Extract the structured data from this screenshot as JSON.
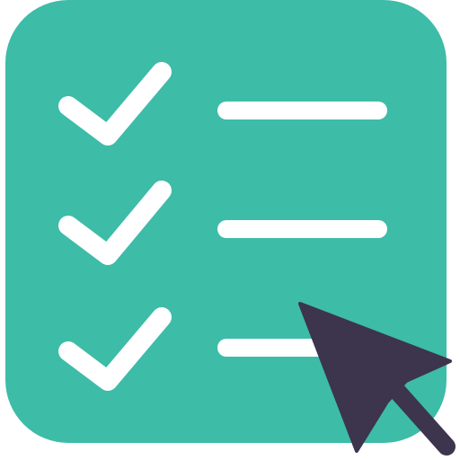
{
  "icon": {
    "name": "checklist-with-cursor-icon",
    "colors": {
      "panel": "#3DBCA8",
      "lines": "#FFFFFF",
      "cursor": "#3D344E",
      "background": "#FFFFFF"
    },
    "items": [
      {
        "checked": true,
        "icon": "check-icon"
      },
      {
        "checked": true,
        "icon": "check-icon"
      },
      {
        "checked": true,
        "icon": "check-icon"
      }
    ],
    "cursor_icon": "cursor-arrow-icon"
  }
}
